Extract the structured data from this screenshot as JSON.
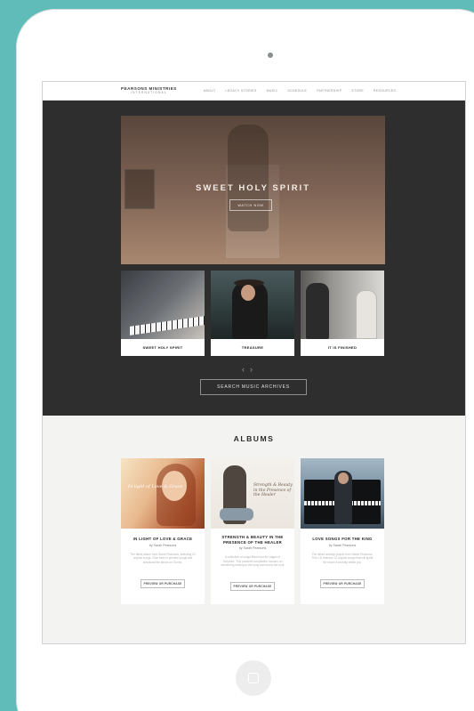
{
  "nav": {
    "logo_line1": "PEARSONS MINISTRIES",
    "logo_line2": "INTERNATIONAL",
    "menu": [
      "About",
      "Legacy Stories",
      "Music",
      "Schedule",
      "Partnership",
      "Store",
      "Resources"
    ]
  },
  "hero": {
    "title": "SWEET HOLY SPIRIT",
    "button": "WATCH NOW"
  },
  "videos": [
    {
      "caption": "SWEET HOLY SPIRIT"
    },
    {
      "caption": "TREASURE"
    },
    {
      "caption": "IT IS FINISHED"
    }
  ],
  "carousel": {
    "prev": "‹",
    "next": "›"
  },
  "archive_button": "SEARCH MUSIC ARCHIVES",
  "albums_heading": "ALBUMS",
  "albums": [
    {
      "title": "IN LIGHT OF LOVE & GRACE",
      "by": "by Sarah Pearsons",
      "cover_text": "In light of Love & Grace",
      "desc": "The latest album from Sarah Pearsons, featuring 10 original songs. Click here to preview songs and download the album on iTunes.",
      "button": "PREVIEW OR PURCHASE"
    },
    {
      "title": "STRENGTH & BEAUTY IN THE PRESENCE OF THE HEALER",
      "by": "by Sarah Pearsons",
      "cover_text": "Strength & Beauty in the Presence of the Healer",
      "desc": "A collection of songs lifted from the pages of Scripture. This powerful compilation focuses on ministering healing to the body and rest to the soul.",
      "button": "PREVIEW OR PURCHASE"
    },
    {
      "title": "LOVE SONGS FOR THE KING",
      "by": "by Sarah Pearsons",
      "desc": "The debut worship project from Sarah Pearsons. This CD features 12 original songs that will ignite the heart of worship within you.",
      "button": "PREVIEW OR PURCHASE"
    }
  ]
}
